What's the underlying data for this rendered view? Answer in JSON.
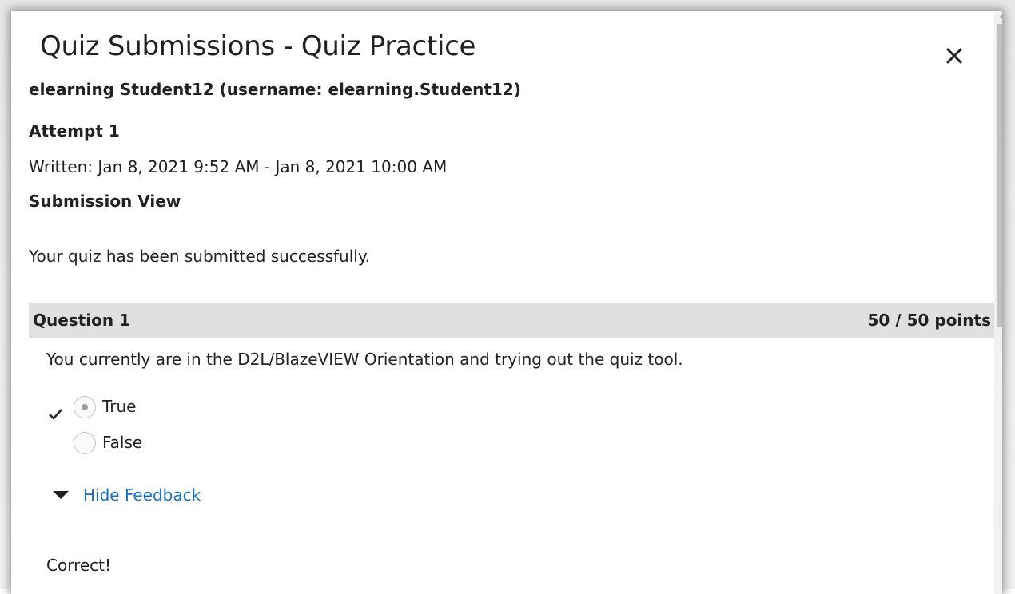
{
  "dialog": {
    "title": "Quiz Submissions - Quiz Practice",
    "close_icon": "close-icon"
  },
  "student": {
    "name_line": "elearning Student12 (username: elearning.Student12)"
  },
  "attempt": {
    "label": "Attempt 1",
    "written": "Written: Jan 8, 2021 9:52 AM - Jan 8, 2021 10:00 AM",
    "view_label": "Submission View",
    "message": "Your quiz has been submitted successfully."
  },
  "question": {
    "title": "Question 1",
    "points": "50 / 50 points",
    "text": "You currently are in the D2L/BlazeVIEW Orientation and trying out the quiz tool.",
    "options": [
      {
        "label": "True",
        "selected": true,
        "correct_marker": true
      },
      {
        "label": "False",
        "selected": false,
        "correct_marker": false
      }
    ],
    "feedback_toggle": "Hide Feedback",
    "feedback_text": "Correct!"
  },
  "colors": {
    "link": "#1a6fbf",
    "question_bar": "#e0e0e0"
  }
}
